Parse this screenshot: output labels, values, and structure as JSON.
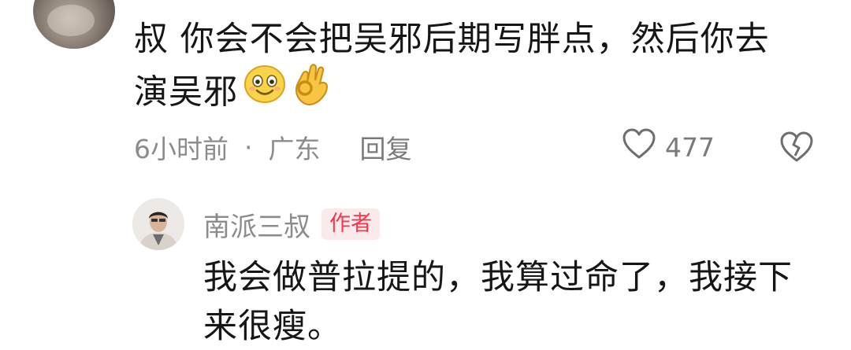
{
  "comment": {
    "text_line1": "叔 你会不会把吴邪后期写胖点，然后你去",
    "text_line2": "演吴邪",
    "emojis": [
      "smile-emoji-icon",
      "ok-hand-emoji-icon"
    ],
    "time": "6小时前",
    "separator": "·",
    "location": "广东",
    "reply_label": "回复",
    "like_count": "477"
  },
  "reply": {
    "author": "南派三叔",
    "badge": "作者",
    "text_line1": "我会做普拉提的，我算过命了，我接下",
    "text_line2": "来很瘦。"
  },
  "colors": {
    "text": "#161616",
    "meta": "#8c8c8c",
    "badge_bg": "#fbeaec",
    "badge_text": "#f0384f"
  }
}
